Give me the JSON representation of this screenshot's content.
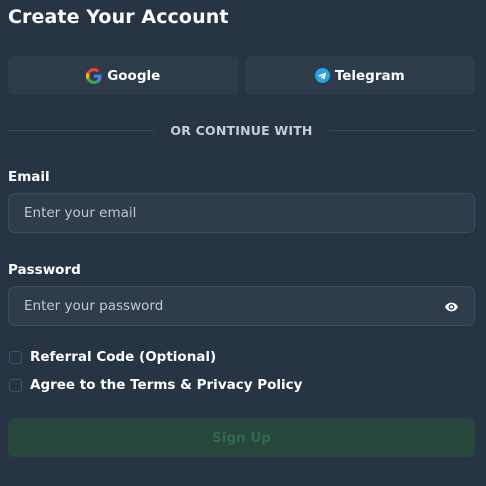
{
  "form": {
    "title": "Create Your Account",
    "social": {
      "google_label": "Google",
      "telegram_label": "Telegram"
    },
    "divider_text": "OR CONTINUE WITH",
    "email": {
      "label": "Email",
      "placeholder": "Enter your email",
      "value": ""
    },
    "password": {
      "label": "Password",
      "placeholder": "Enter your password",
      "value": "",
      "visibility_icon": "eye-icon"
    },
    "checkboxes": {
      "referral": {
        "label": "Referral Code (Optional)",
        "checked": false
      },
      "terms": {
        "label": "Agree to the Terms & Privacy Policy",
        "checked": false
      }
    },
    "submit_label": "Sign Up",
    "submit_disabled": true
  },
  "colors": {
    "background": "#263444",
    "card": "#2d3b4b",
    "input_bg": "#2e3c4c",
    "input_border": "#3e4d5e",
    "submit_bg_disabled": "#27473c",
    "submit_text_disabled": "#2f6a4c",
    "telegram_blue": "#2aa3df"
  }
}
